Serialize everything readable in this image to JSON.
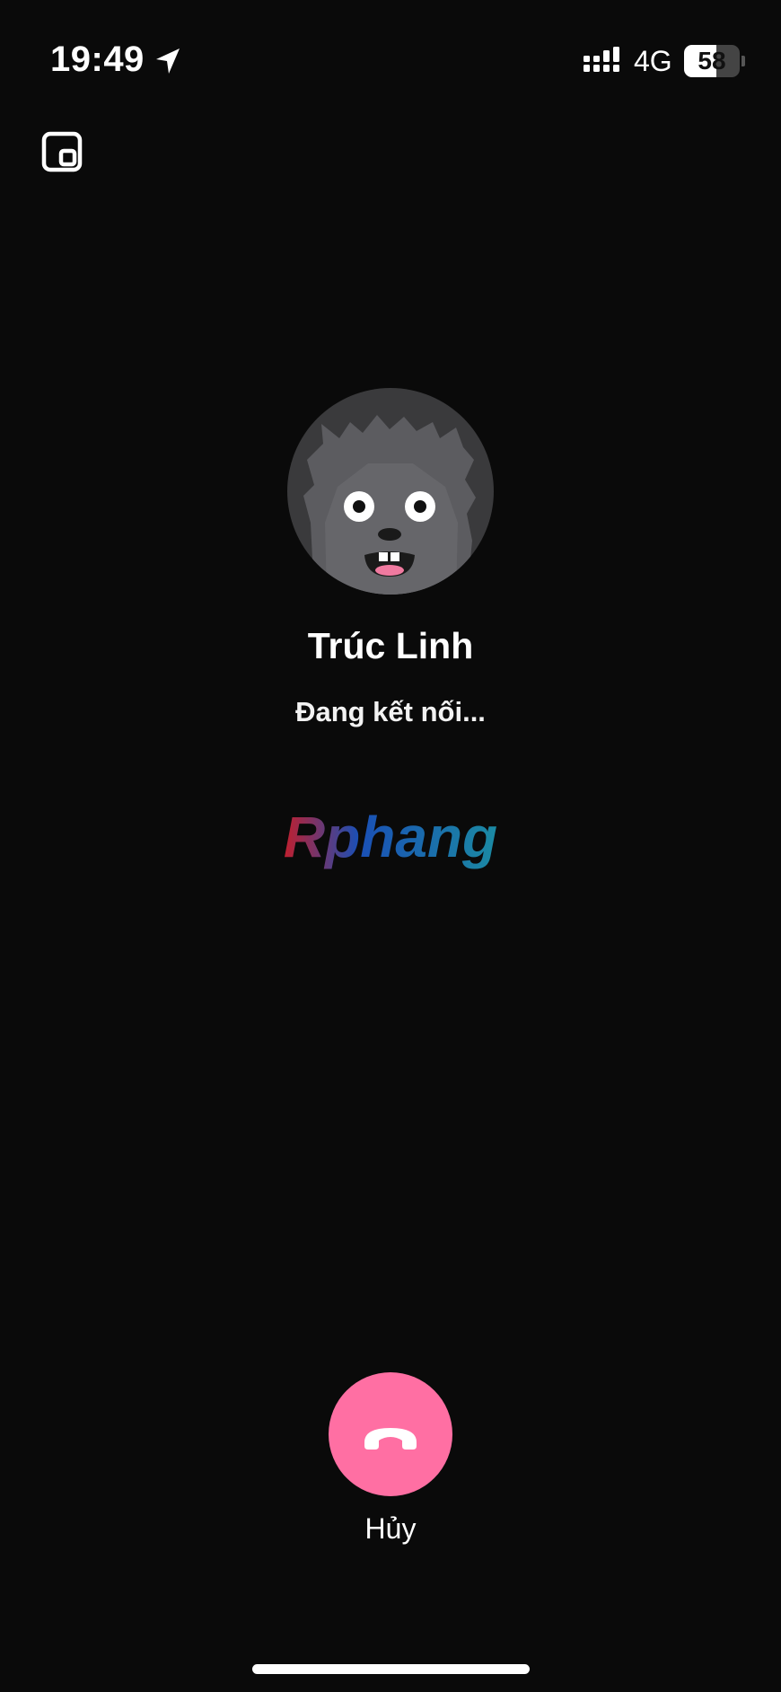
{
  "status_bar": {
    "time": "19:49",
    "network": "4G",
    "battery_level": "58",
    "icons": [
      "location-arrow-icon",
      "signal-icon",
      "battery-icon"
    ]
  },
  "controls": {
    "pip_icon": "picture-in-picture-icon"
  },
  "contact": {
    "name": "Trúc Linh",
    "avatar_icon": "monster-avatar"
  },
  "call": {
    "status": "Đang kết nối...",
    "end_label": "Hủy",
    "end_icon": "hang-up-phone-icon"
  },
  "watermark": {
    "text": "Rphang"
  },
  "colors": {
    "background": "#0a0a0a",
    "end_call": "#ff6fa3",
    "watermark_red": "#c01f2e",
    "watermark_blue": "#1a4fb5",
    "watermark_teal": "#1b8aa3"
  }
}
